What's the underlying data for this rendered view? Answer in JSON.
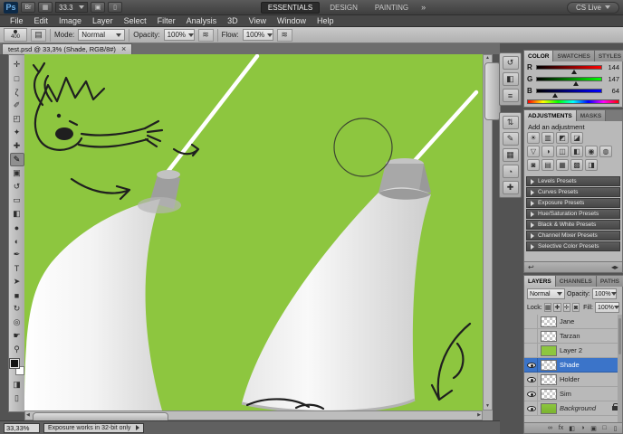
{
  "app": {
    "logo": "Ps",
    "zoom_field": "33.3",
    "workspaces": [
      "ESSENTIALS",
      "DESIGN",
      "PAINTING"
    ],
    "workspace_overflow": "»",
    "cs_live": "CS Live",
    "menus": [
      "File",
      "Edit",
      "Image",
      "Layer",
      "Select",
      "Filter",
      "Analysis",
      "3D",
      "View",
      "Window",
      "Help"
    ],
    "appbar_icons": [
      {
        "name": "bridge-icon",
        "glyph": "Br"
      },
      {
        "name": "view-extras-icon",
        "glyph": "▦"
      },
      {
        "name": "arrange-documents-icon",
        "glyph": "▣"
      },
      {
        "name": "screen-mode-icon",
        "glyph": "▯"
      }
    ]
  },
  "options": {
    "brush_size": "400",
    "mode_label": "Mode:",
    "mode_value": "Normal",
    "opacity_label": "Opacity:",
    "opacity_value": "100%",
    "flow_label": "Flow:",
    "flow_value": "100%",
    "airbrush_glyph": "≋",
    "brush_panel_glyph": "▤"
  },
  "doc": {
    "tab_title": "test.psd @ 33,3% (Shade, RGB/8#)",
    "close_glyph": "×"
  },
  "status": {
    "zoom": "33,33%",
    "message": "Exposure works in 32-bit only"
  },
  "dock_icons": [
    {
      "name": "history-panel-icon",
      "glyph": "↺"
    },
    {
      "name": "properties-panel-icon",
      "glyph": "◧"
    },
    {
      "name": "info-panel-icon",
      "glyph": "≡"
    },
    {
      "name": "navigator-panel-icon",
      "glyph": "⇅"
    },
    {
      "name": "notes-panel-icon",
      "glyph": "✎"
    },
    {
      "name": "histogram-panel-icon",
      "glyph": "▦"
    },
    {
      "name": "timer-panel-icon",
      "glyph": "◔"
    },
    {
      "name": "brushes-panel-icon",
      "glyph": "✚"
    }
  ],
  "color_panel": {
    "tabs": [
      "COLOR",
      "SWATCHES",
      "STYLES"
    ],
    "channels": [
      {
        "label": "R",
        "value": "144"
      },
      {
        "label": "G",
        "value": "147"
      },
      {
        "label": "B",
        "value": "64"
      }
    ]
  },
  "adjustments": {
    "tabs": [
      "ADJUSTMENTS",
      "MASKS"
    ],
    "heading": "Add an adjustment",
    "icons": [
      {
        "name": "brightness-contrast-icon",
        "glyph": "☀"
      },
      {
        "name": "levels-icon",
        "glyph": "▥"
      },
      {
        "name": "curves-icon",
        "glyph": "◩"
      },
      {
        "name": "exposure-icon",
        "glyph": "◪"
      },
      {
        "name": "vibrance-icon",
        "glyph": "▽"
      },
      {
        "name": "hue-saturation-icon",
        "glyph": "◑"
      },
      {
        "name": "color-balance-icon",
        "glyph": "◫"
      },
      {
        "name": "black-white-icon",
        "glyph": "◧"
      },
      {
        "name": "photo-filter-icon",
        "glyph": "◉"
      },
      {
        "name": "channel-mixer-icon",
        "glyph": "◍"
      },
      {
        "name": "invert-icon",
        "glyph": "◙"
      },
      {
        "name": "posterize-icon",
        "glyph": "▤"
      },
      {
        "name": "threshold-icon",
        "glyph": "▦"
      },
      {
        "name": "gradient-map-icon",
        "glyph": "▩"
      },
      {
        "name": "selective-color-icon",
        "glyph": "◨"
      }
    ],
    "presets": [
      "Levels Presets",
      "Curves Presets",
      "Exposure Presets",
      "Hue/Saturation Presets",
      "Black & White Presets",
      "Channel Mixer Presets",
      "Selective Color Presets"
    ],
    "footer_return_glyph": "↩"
  },
  "layers_panel": {
    "tabs": [
      "LAYERS",
      "CHANNELS",
      "PATHS"
    ],
    "blend_mode": "Normal",
    "opacity_label": "Opacity:",
    "opacity_value": "100%",
    "lock_label": "Lock:",
    "lock_icons": [
      {
        "name": "lock-transparency-icon",
        "glyph": "▦"
      },
      {
        "name": "lock-pixels-icon",
        "glyph": "✚"
      },
      {
        "name": "lock-position-icon",
        "glyph": "✛"
      },
      {
        "name": "lock-all-icon",
        "glyph": "◙"
      }
    ],
    "fill_label": "Fill:",
    "fill_value": "100%",
    "layers": [
      {
        "name": "Jane",
        "visible": false,
        "selected": false
      },
      {
        "name": "Tarzan",
        "visible": false,
        "selected": false
      },
      {
        "name": "Layer 2",
        "visible": false,
        "selected": false
      },
      {
        "name": "Shade",
        "visible": true,
        "selected": true
      },
      {
        "name": "Holder",
        "visible": true,
        "selected": false
      },
      {
        "name": "Sim",
        "visible": true,
        "selected": false
      },
      {
        "name": "Background",
        "visible": true,
        "selected": false,
        "locked": true
      }
    ],
    "footer_icons": [
      {
        "name": "link-layers-icon",
        "glyph": "∞"
      },
      {
        "name": "layer-style-icon",
        "glyph": "fx"
      },
      {
        "name": "add-layer-mask-icon",
        "glyph": "◧"
      },
      {
        "name": "adjustment-layer-icon",
        "glyph": "◑"
      },
      {
        "name": "layer-group-icon",
        "glyph": "▣"
      },
      {
        "name": "new-layer-icon",
        "glyph": "□"
      },
      {
        "name": "delete-layer-icon",
        "glyph": "▯"
      }
    ]
  },
  "tools": [
    {
      "name": "move-tool",
      "glyph": "✛"
    },
    {
      "name": "marquee-tool",
      "glyph": "□"
    },
    {
      "name": "lasso-tool",
      "glyph": "ζ"
    },
    {
      "name": "quick-selection-tool",
      "glyph": "✐"
    },
    {
      "name": "crop-tool",
      "glyph": "◰"
    },
    {
      "name": "eyedropper-tool",
      "glyph": "✦"
    },
    {
      "name": "healing-brush-tool",
      "glyph": "✚"
    },
    {
      "name": "brush-tool",
      "glyph": "✎",
      "selected": true
    },
    {
      "name": "clone-stamp-tool",
      "glyph": "▣"
    },
    {
      "name": "history-brush-tool",
      "glyph": "↺"
    },
    {
      "name": "eraser-tool",
      "glyph": "▭"
    },
    {
      "name": "gradient-tool",
      "glyph": "◧"
    },
    {
      "name": "blur-tool",
      "glyph": "●"
    },
    {
      "name": "dodge-tool",
      "glyph": "◐"
    },
    {
      "name": "pen-tool",
      "glyph": "✒"
    },
    {
      "name": "type-tool",
      "glyph": "T"
    },
    {
      "name": "path-selection-tool",
      "glyph": "➤"
    },
    {
      "name": "shape-tool",
      "glyph": "■"
    },
    {
      "name": "rotate-3d-tool",
      "glyph": "↻"
    },
    {
      "name": "camera-3d-tool",
      "glyph": "◎"
    },
    {
      "name": "hand-tool",
      "glyph": "☛"
    },
    {
      "name": "zoom-tool",
      "glyph": "⚲"
    }
  ],
  "colors": {
    "canvas_green": "#8dc63f",
    "selection_blue": "#3b74c9"
  }
}
